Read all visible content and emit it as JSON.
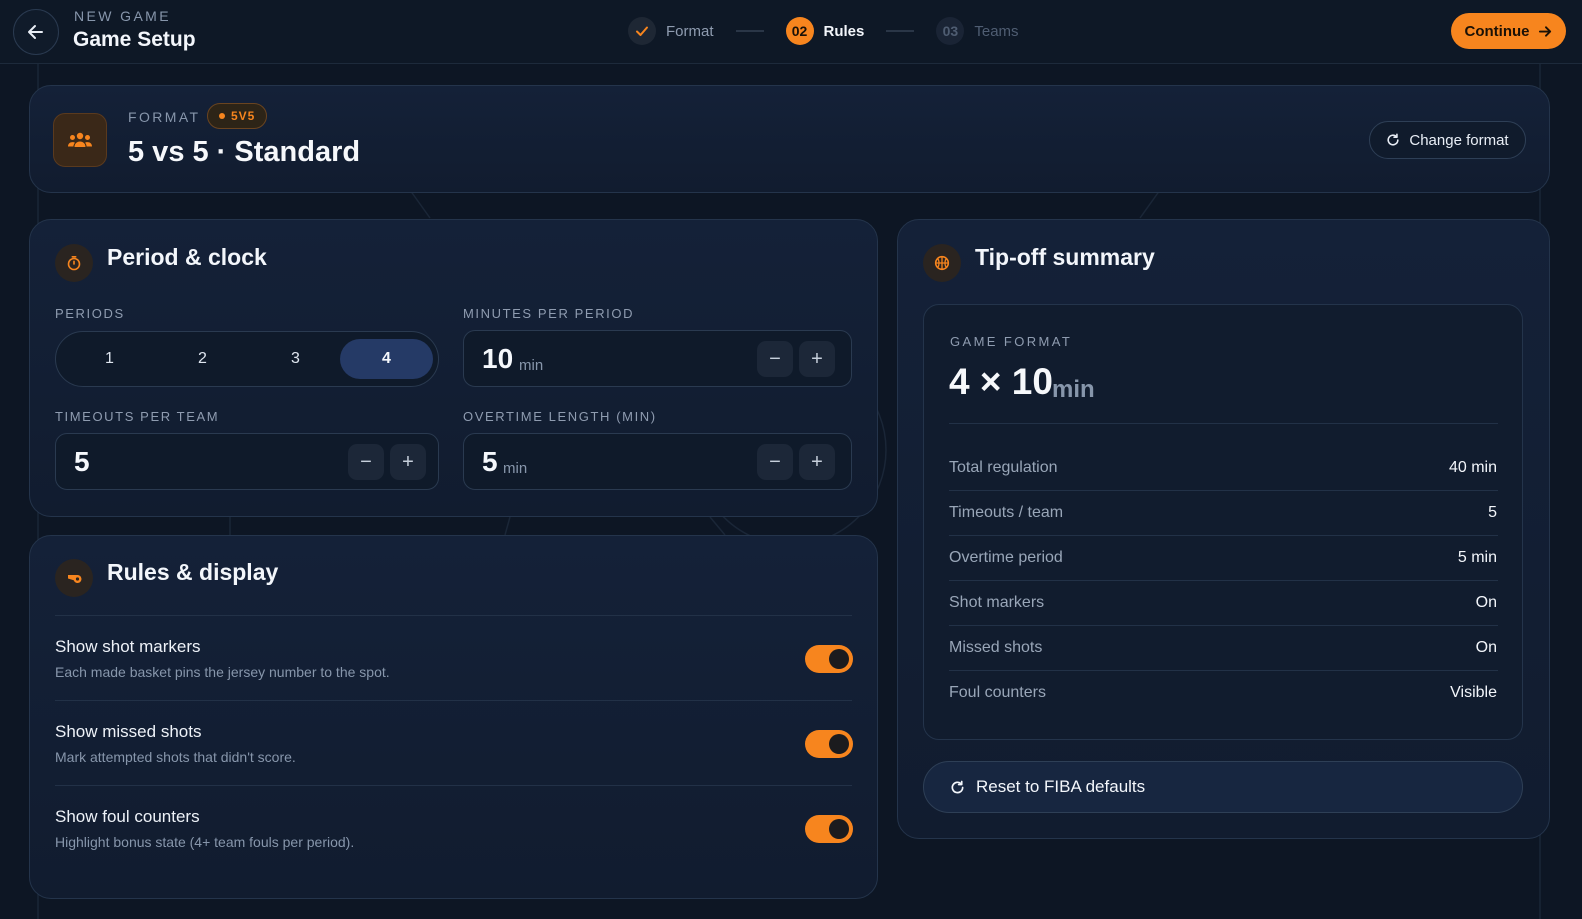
{
  "header": {
    "eyebrow": "NEW GAME",
    "title": "Game Setup",
    "steps": [
      {
        "number": "✓",
        "label": "Format",
        "state": "done"
      },
      {
        "number": "02",
        "label": "Rules",
        "state": "active"
      },
      {
        "number": "03",
        "label": "Teams",
        "state": "future"
      }
    ],
    "continue_label": "Continue"
  },
  "format": {
    "eyebrow": "FORMAT",
    "badge": "5V5",
    "title": "5 vs 5 · Standard",
    "change_label": "Change format"
  },
  "clock": {
    "title": "Period & clock",
    "periods_label": "PERIODS",
    "period_options": [
      "1",
      "2",
      "3",
      "4"
    ],
    "period_selected": "4",
    "minutes_label": "MINUTES PER PERIOD",
    "minutes_value": "10",
    "minutes_unit": "min",
    "timeouts_label": "TIMEOUTS PER TEAM",
    "timeouts_value": "5",
    "overtime_label": "OVERTIME LENGTH (MIN)",
    "overtime_value": "5",
    "overtime_unit": "min",
    "minus": "−",
    "plus": "+"
  },
  "rules": {
    "title": "Rules & display",
    "items": [
      {
        "title": "Show shot markers",
        "desc": "Each made basket pins the jersey number to the spot.",
        "on": true
      },
      {
        "title": "Show missed shots",
        "desc": "Mark attempted shots that didn't score.",
        "on": true
      },
      {
        "title": "Show foul counters",
        "desc": "Highlight bonus state (4+ team fouls per period).",
        "on": true
      }
    ]
  },
  "summary": {
    "title": "Tip-off summary",
    "eyebrow": "GAME FORMAT",
    "big_value": "4 × 10",
    "big_unit": "min",
    "rows": [
      {
        "key": "Total regulation",
        "value": "40 min"
      },
      {
        "key": "Timeouts / team",
        "value": "5"
      },
      {
        "key": "Overtime period",
        "value": "5 min"
      },
      {
        "key": "Shot markers",
        "value": "On"
      },
      {
        "key": "Missed shots",
        "value": "On"
      },
      {
        "key": "Foul counters",
        "value": "Visible"
      }
    ],
    "reset_label": "Reset to FIBA defaults"
  },
  "colors": {
    "accent": "#f7851e",
    "background": "#0d1624",
    "card": "#13203a",
    "selected": "#253a66"
  }
}
